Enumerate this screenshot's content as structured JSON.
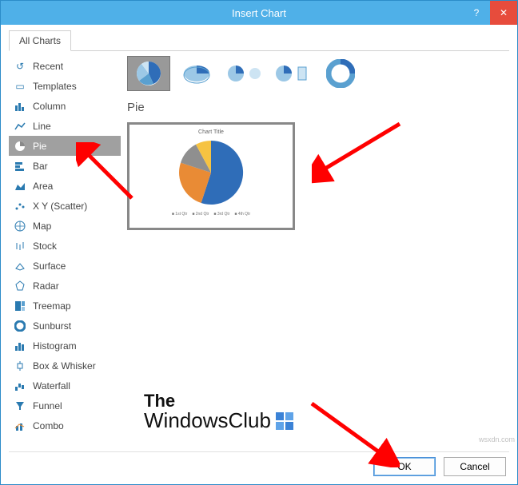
{
  "window": {
    "title": "Insert Chart",
    "help_label": "?",
    "close_label": "✕"
  },
  "tabs": {
    "all_charts": "All Charts"
  },
  "sidebar": {
    "items": [
      {
        "label": "Recent"
      },
      {
        "label": "Templates"
      },
      {
        "label": "Column"
      },
      {
        "label": "Line"
      },
      {
        "label": "Pie",
        "selected": true
      },
      {
        "label": "Bar"
      },
      {
        "label": "Area"
      },
      {
        "label": "X Y (Scatter)"
      },
      {
        "label": "Map"
      },
      {
        "label": "Stock"
      },
      {
        "label": "Surface"
      },
      {
        "label": "Radar"
      },
      {
        "label": "Treemap"
      },
      {
        "label": "Sunburst"
      },
      {
        "label": "Histogram"
      },
      {
        "label": "Box & Whisker"
      },
      {
        "label": "Waterfall"
      },
      {
        "label": "Funnel"
      },
      {
        "label": "Combo"
      }
    ]
  },
  "content": {
    "chart_type_name": "Pie",
    "preview_title": "Chart Title",
    "legend": [
      "1st Qtr",
      "2nd Qtr",
      "3rd Qtr",
      "4th Qtr"
    ]
  },
  "buttons": {
    "ok": "OK",
    "cancel": "Cancel"
  },
  "watermark": {
    "line1": "The",
    "line2": "WindowsClub"
  },
  "chart_data": {
    "type": "pie",
    "title": "Chart Title",
    "categories": [
      "1st Qtr",
      "2nd Qtr",
      "3rd Qtr",
      "4th Qtr"
    ],
    "values": [
      55,
      25,
      12,
      8
    ],
    "colors": [
      "#2f6db8",
      "#e98b35",
      "#8f8f8f",
      "#f6c342"
    ]
  },
  "url_text": "wsxdn.com"
}
